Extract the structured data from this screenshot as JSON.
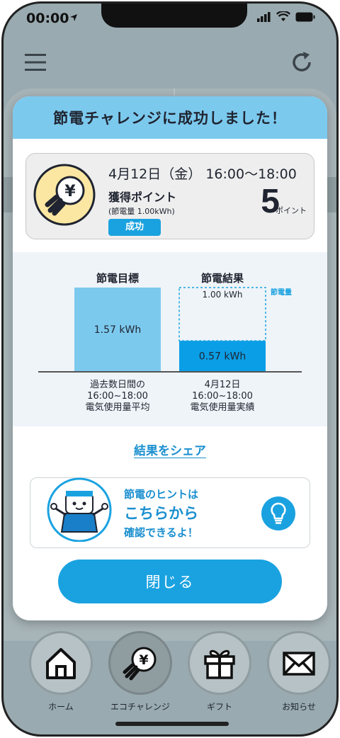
{
  "status_bar": {
    "time": "00:00"
  },
  "modal": {
    "title": "節電チャレンジに成功しました！",
    "result": {
      "date": "4月12日（金）",
      "time_range": "16:00〜18:00",
      "points_label": "獲得ポイント",
      "saved_amount": "(節電量 1.00kWh)",
      "status_badge": "成功",
      "points": "5",
      "points_unit": "ポイント"
    },
    "chart": {
      "target_label": "節電目標",
      "result_label": "節電結果",
      "target_value_label": "1.57 kWh",
      "result_value_label": "0.57 kWh",
      "saved_value_label": "1.00 kWh",
      "saved_legend": "節電量",
      "target_caption": [
        "過去数日間の",
        "16:00~18:00",
        "電気使用量平均"
      ],
      "result_caption": [
        "4月12日",
        "16:00~18:00",
        "電気使用量実績"
      ]
    },
    "share_link": "結果をシェア",
    "hint": {
      "line1": "節電のヒントは",
      "line2": "こちらから",
      "line3": "確認できるよ！"
    },
    "close_button": "閉じる"
  },
  "chart_data": {
    "type": "bar",
    "categories": [
      "節電目標",
      "節電結果"
    ],
    "values": [
      1.57,
      0.57
    ],
    "stacked_saved": 1.0,
    "unit": "kWh",
    "colors": {
      "target": "#7cc9ee",
      "result": "#0a9ee6",
      "saved_outline": "#1aa2e0"
    }
  },
  "tab_bar": {
    "items": [
      {
        "label": "ホーム",
        "icon": "home-icon"
      },
      {
        "label": "エコチャレンジ",
        "icon": "eco-challenge-icon"
      },
      {
        "label": "ギフト",
        "icon": "gift-icon"
      },
      {
        "label": "お知らせ",
        "icon": "mail-icon"
      }
    ]
  },
  "colors": {
    "accent": "#1aa2e0",
    "header_bg": "#7cc9ee",
    "background": "#99aab0"
  }
}
